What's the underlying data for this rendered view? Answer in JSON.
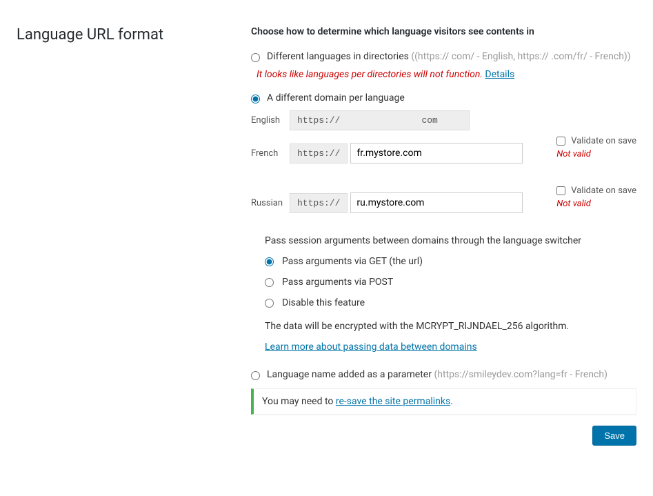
{
  "title": "Language URL format",
  "heading": "Choose how to determine which language visitors see contents in",
  "option_directories": {
    "label": "Different languages in directories",
    "hint": "((https://            com/ - English, https://            .com/fr/ - French))",
    "selected": false
  },
  "warning": {
    "text": "It looks like languages per directories will not function.",
    "link": "Details"
  },
  "option_domain": {
    "label": "A different domain per language",
    "selected": true
  },
  "languages": {
    "english": {
      "name": "English",
      "prefix": "https://",
      "tld": "com"
    },
    "french": {
      "name": "French",
      "prefix": "https://",
      "value": "fr.mystore.com",
      "validate_label": "Validate on save",
      "validate_checked": false,
      "status": "Not valid"
    },
    "russian": {
      "name": "Russian",
      "prefix": "https://",
      "value": "ru.mystore.com",
      "validate_label": "Validate on save",
      "validate_checked": false,
      "status": "Not valid"
    }
  },
  "session": {
    "heading": "Pass session arguments between domains through the language switcher",
    "opt_get": "Pass arguments via GET (the url)",
    "opt_post": "Pass arguments via POST",
    "opt_disable": "Disable this feature",
    "selected": "get",
    "encrypt_note": "The data will be encrypted with the MCRYPT_RIJNDAEL_256 algorithm.",
    "learn_link": "Learn more about passing data between domains"
  },
  "option_param": {
    "label": "Language name added as a parameter",
    "hint": "(https://smileydev.com?lang=fr - French)",
    "selected": false
  },
  "notice": {
    "prefix": "You may need to ",
    "link": "re-save the site permalinks",
    "suffix": "."
  },
  "save_button": "Save"
}
